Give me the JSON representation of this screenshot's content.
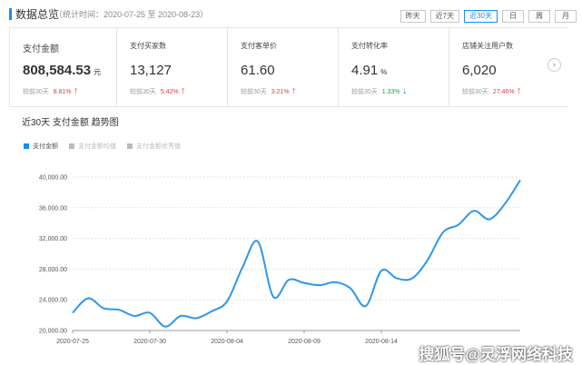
{
  "header": {
    "title": "数据总览",
    "subtitle": "（统计时间：2020-07-25 至 2020-08-23）",
    "range_buttons": [
      {
        "label": "昨天",
        "active": false
      },
      {
        "label": "近7天",
        "active": false
      },
      {
        "label": "近30天",
        "active": true
      },
      {
        "label": "日",
        "active": false
      },
      {
        "label": "周",
        "active": false
      },
      {
        "label": "月",
        "active": false
      }
    ]
  },
  "metrics": [
    {
      "label": "支付金额",
      "value": "808,584.53",
      "unit": "元",
      "compare_label": "较前30天",
      "pct": "8.81%",
      "direction": "up"
    },
    {
      "label": "支付买家数",
      "value": "13,127",
      "unit": "",
      "compare_label": "较前30天",
      "pct": "5.42%",
      "direction": "up"
    },
    {
      "label": "支付客单价",
      "value": "61.60",
      "unit": "",
      "compare_label": "较前30天",
      "pct": "3.21%",
      "direction": "up"
    },
    {
      "label": "支付转化率",
      "value": "4.91",
      "unit": "%",
      "compare_label": "较前30天",
      "pct": "1.33%",
      "direction": "down"
    },
    {
      "label": "店铺关注用户数",
      "value": "6,020",
      "unit": "",
      "compare_label": "较前30天",
      "pct": "27.46%",
      "direction": "up"
    }
  ],
  "chart_section": {
    "title": "近30天 支付金额 趋势图",
    "legend": [
      {
        "label": "支付金额",
        "color": "#1a8cf0",
        "active": true
      },
      {
        "label": "支付金额均值",
        "color": "#bbbbbb",
        "active": false
      },
      {
        "label": "支付金额优秀值",
        "color": "#bbbbbb",
        "active": false
      }
    ]
  },
  "watermark": "搜狐号@灵浮网络科技",
  "colors": {
    "accent": "#1a8cf0",
    "up": "#e03a3a",
    "down": "#2a9a3a",
    "line": "#2f96e8"
  },
  "chart_data": {
    "type": "line",
    "title": "近30天 支付金额 趋势图",
    "xlabel": "",
    "ylabel": "",
    "ylim": [
      20000,
      40000
    ],
    "yticks": [
      "20,000.00",
      "24,000.00",
      "28,000.00",
      "32,000.00",
      "36,000.00",
      "40,000.00"
    ],
    "ytick_values": [
      20000,
      24000,
      28000,
      32000,
      36000,
      40000
    ],
    "xtick_labels": [
      "2020-07-25",
      "2020-07-30",
      "2020-08-04",
      "2020-08-09",
      "2020-08-14"
    ],
    "xtick_index": [
      0,
      5,
      10,
      15,
      20
    ],
    "grid": true,
    "x": [
      "2020-07-25",
      "2020-07-26",
      "2020-07-27",
      "2020-07-28",
      "2020-07-29",
      "2020-07-30",
      "2020-07-31",
      "2020-08-01",
      "2020-08-02",
      "2020-08-03",
      "2020-08-04",
      "2020-08-05",
      "2020-08-06",
      "2020-08-07",
      "2020-08-08",
      "2020-08-09",
      "2020-08-10",
      "2020-08-11",
      "2020-08-12",
      "2020-08-13",
      "2020-08-14",
      "2020-08-15",
      "2020-08-16",
      "2020-08-17",
      "2020-08-18",
      "2020-08-19",
      "2020-08-20",
      "2020-08-21",
      "2020-08-22",
      "2020-08-23"
    ],
    "series": [
      {
        "name": "支付金额",
        "values": [
          22300,
          24200,
          22900,
          22700,
          21900,
          22300,
          20500,
          21900,
          21600,
          22500,
          23800,
          28200,
          31600,
          24400,
          26600,
          26200,
          25900,
          26300,
          25500,
          23200,
          27800,
          26800,
          26800,
          29200,
          32800,
          33800,
          35600,
          34500,
          36500,
          39600
        ]
      }
    ]
  }
}
